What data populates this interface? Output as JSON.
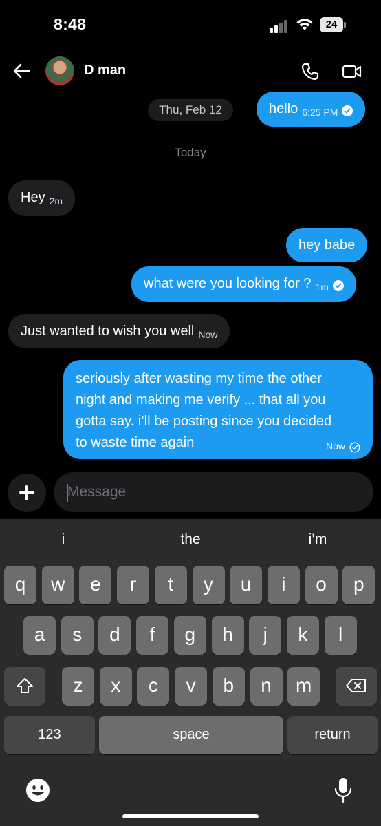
{
  "status_bar": {
    "time": "8:48",
    "battery": "24"
  },
  "header": {
    "contact_name": "D man"
  },
  "chat": {
    "date_separator": "Thu, Feb 12",
    "today_label": "Today",
    "messages": [
      {
        "direction": "out",
        "text": "hello",
        "time": "6:25 PM"
      },
      {
        "direction": "in",
        "text": "Hey",
        "time": "2m"
      },
      {
        "direction": "out",
        "text": "hey babe",
        "time": ""
      },
      {
        "direction": "out",
        "text": "what were you looking for ?",
        "time": "1m"
      },
      {
        "direction": "in",
        "text": "Just wanted to wish you well",
        "time": "Now"
      },
      {
        "direction": "out",
        "lines": [
          "seriously after wasting my time the other",
          "night and making me verify ... that all you",
          "gotta say. i’ll be posting since you decided",
          "to waste time again"
        ],
        "time": "Now"
      }
    ]
  },
  "composer": {
    "placeholder": "Message"
  },
  "keyboard": {
    "suggestions": [
      "i",
      "the",
      "i’m"
    ],
    "row1": [
      "q",
      "w",
      "e",
      "r",
      "t",
      "y",
      "u",
      "i",
      "o",
      "p"
    ],
    "row2": [
      "a",
      "s",
      "d",
      "f",
      "g",
      "h",
      "j",
      "k",
      "l"
    ],
    "row3": [
      "z",
      "x",
      "c",
      "v",
      "b",
      "n",
      "m"
    ],
    "numbers_label": "123",
    "space_label": "space",
    "return_label": "return"
  },
  "colors": {
    "outgoing_bubble": "#1d9bf0",
    "incoming_bubble": "#1f1f22",
    "background": "#000000",
    "keyboard_bg": "#2b2b2d"
  }
}
